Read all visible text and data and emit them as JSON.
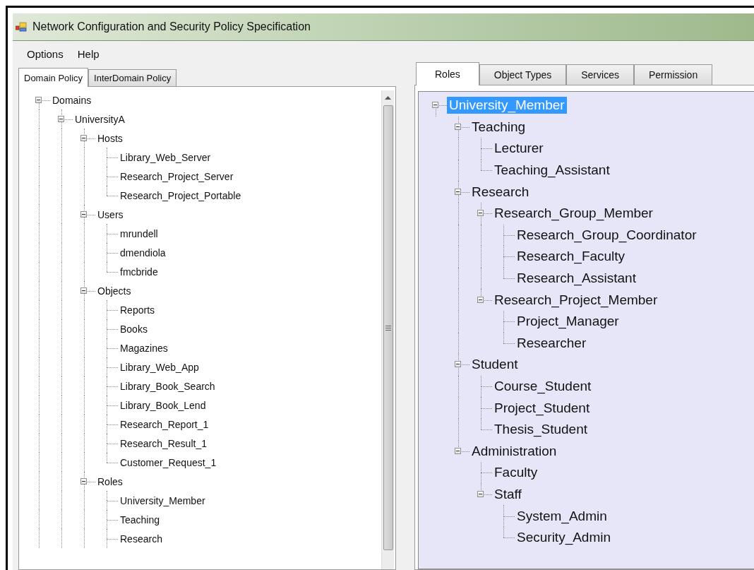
{
  "window": {
    "title": "Network Configuration and Security Policy Specification"
  },
  "menu": [
    "Options",
    "Help"
  ],
  "left_panel": {
    "tabs": [
      {
        "label": "Domain Policy",
        "selected": true
      },
      {
        "label": "InterDomain Policy",
        "selected": false
      }
    ],
    "tree": [
      {
        "label": "Domains",
        "expanded": true,
        "selected": false,
        "children": [
          {
            "label": "UniversityA",
            "expanded": true,
            "selected": false,
            "children": [
              {
                "label": "Hosts",
                "expanded": true,
                "selected": false,
                "children": [
                  {
                    "label": "Library_Web_Server",
                    "selected": false
                  },
                  {
                    "label": "Research_Project_Server",
                    "selected": false
                  },
                  {
                    "label": "Research_Project_Portable",
                    "selected": false
                  }
                ]
              },
              {
                "label": "Users",
                "expanded": true,
                "selected": false,
                "children": [
                  {
                    "label": "mrundell",
                    "selected": false
                  },
                  {
                    "label": "dmendiola",
                    "selected": false
                  },
                  {
                    "label": "fmcbride",
                    "selected": false
                  }
                ]
              },
              {
                "label": "Objects",
                "expanded": true,
                "selected": false,
                "children": [
                  {
                    "label": "Reports",
                    "selected": false
                  },
                  {
                    "label": "Books",
                    "selected": false
                  },
                  {
                    "label": "Magazines",
                    "selected": false
                  },
                  {
                    "label": "Library_Web_App",
                    "selected": false
                  },
                  {
                    "label": "Library_Book_Search",
                    "selected": false
                  },
                  {
                    "label": "Library_Book_Lend",
                    "selected": false
                  },
                  {
                    "label": "Research_Report_1",
                    "selected": false
                  },
                  {
                    "label": "Research_Result_1",
                    "selected": false
                  },
                  {
                    "label": "Customer_Request_1",
                    "selected": false
                  }
                ]
              },
              {
                "label": "Roles",
                "expanded": true,
                "selected": false,
                "children": [
                  {
                    "label": "University_Member",
                    "selected": false
                  },
                  {
                    "label": "Teaching",
                    "selected": false
                  },
                  {
                    "label": "Research",
                    "selected": false
                  }
                ]
              }
            ]
          }
        ]
      }
    ]
  },
  "right_panel": {
    "tabs": [
      {
        "label": "Roles",
        "selected": true
      },
      {
        "label": "Object Types",
        "selected": false
      },
      {
        "label": "Services",
        "selected": false
      },
      {
        "label": "Permission",
        "selected": false
      }
    ],
    "tree": [
      {
        "label": "University_Member",
        "expanded": true,
        "selected": true,
        "children": [
          {
            "label": "Teaching",
            "expanded": true,
            "selected": false,
            "children": [
              {
                "label": "Lecturer",
                "selected": false
              },
              {
                "label": "Teaching_Assistant",
                "selected": false
              }
            ]
          },
          {
            "label": "Research",
            "expanded": true,
            "selected": false,
            "children": [
              {
                "label": "Research_Group_Member",
                "expanded": true,
                "selected": false,
                "children": [
                  {
                    "label": "Research_Group_Coordinator",
                    "selected": false
                  },
                  {
                    "label": "Research_Faculty",
                    "selected": false
                  },
                  {
                    "label": "Research_Assistant",
                    "selected": false
                  }
                ]
              },
              {
                "label": "Research_Project_Member",
                "expanded": true,
                "selected": false,
                "children": [
                  {
                    "label": "Project_Manager",
                    "selected": false
                  },
                  {
                    "label": "Researcher",
                    "selected": false
                  }
                ]
              }
            ]
          },
          {
            "label": "Student",
            "expanded": true,
            "selected": false,
            "children": [
              {
                "label": "Course_Student",
                "selected": false
              },
              {
                "label": "Project_Student",
                "selected": false
              },
              {
                "label": "Thesis_Student",
                "selected": false
              }
            ]
          },
          {
            "label": "Administration",
            "expanded": true,
            "selected": false,
            "children": [
              {
                "label": "Faculty",
                "selected": false
              },
              {
                "label": "Staff",
                "expanded": true,
                "selected": false,
                "children": [
                  {
                    "label": "System_Admin",
                    "selected": false
                  },
                  {
                    "label": "Security_Admin",
                    "selected": false
                  }
                ]
              }
            ]
          }
        ]
      }
    ]
  }
}
